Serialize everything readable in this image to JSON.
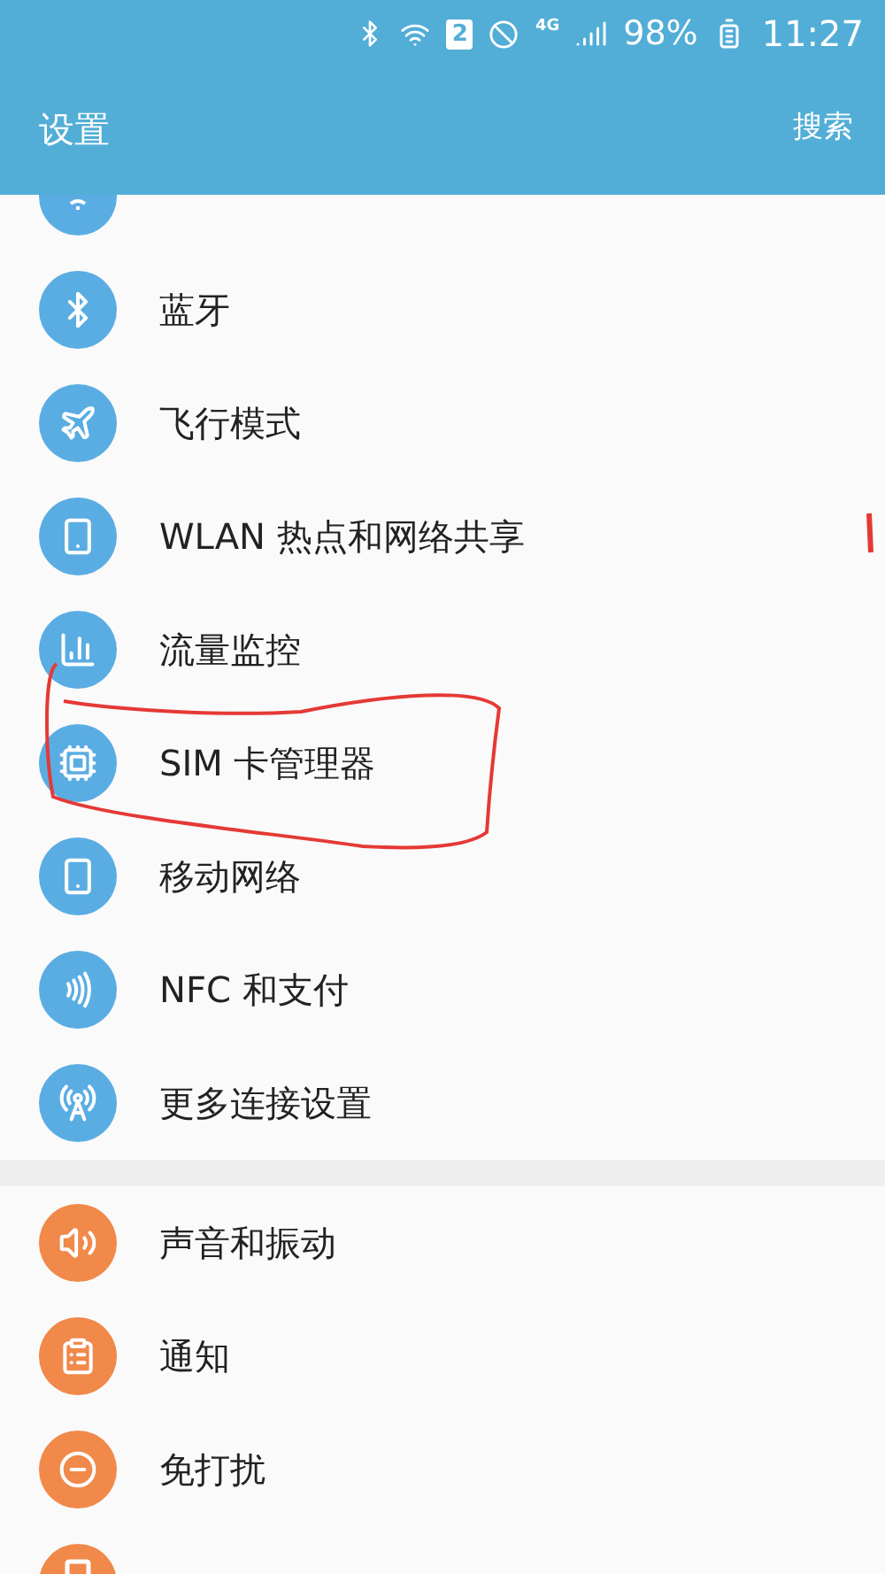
{
  "status_bar": {
    "sim_badge": "2",
    "network": "4G",
    "battery": "98%",
    "time": "11:27"
  },
  "header": {
    "title": "设置",
    "action": "搜索"
  },
  "sections": [
    {
      "color": "#5aade3",
      "items": [
        {
          "kind": "wifi",
          "partial": true
        },
        {
          "label": "蓝牙",
          "kind": "bluetooth"
        },
        {
          "label": "飞行模式",
          "kind": "plane"
        },
        {
          "label": "WLAN 热点和网络共享",
          "kind": "hotspot"
        },
        {
          "label": "流量监控",
          "kind": "usage"
        },
        {
          "label": "SIM 卡管理器",
          "kind": "sim"
        },
        {
          "label": "移动网络",
          "kind": "mobile"
        },
        {
          "label": "NFC 和支付",
          "kind": "nfc"
        },
        {
          "label": "更多连接设置",
          "kind": "more"
        }
      ]
    },
    {
      "color": "#f0894a",
      "items": [
        {
          "label": "声音和振动",
          "kind": "sound"
        },
        {
          "label": "通知",
          "kind": "notice"
        },
        {
          "label": "免打扰",
          "kind": "dnd"
        },
        {
          "kind": "display",
          "partial": true
        }
      ]
    }
  ]
}
